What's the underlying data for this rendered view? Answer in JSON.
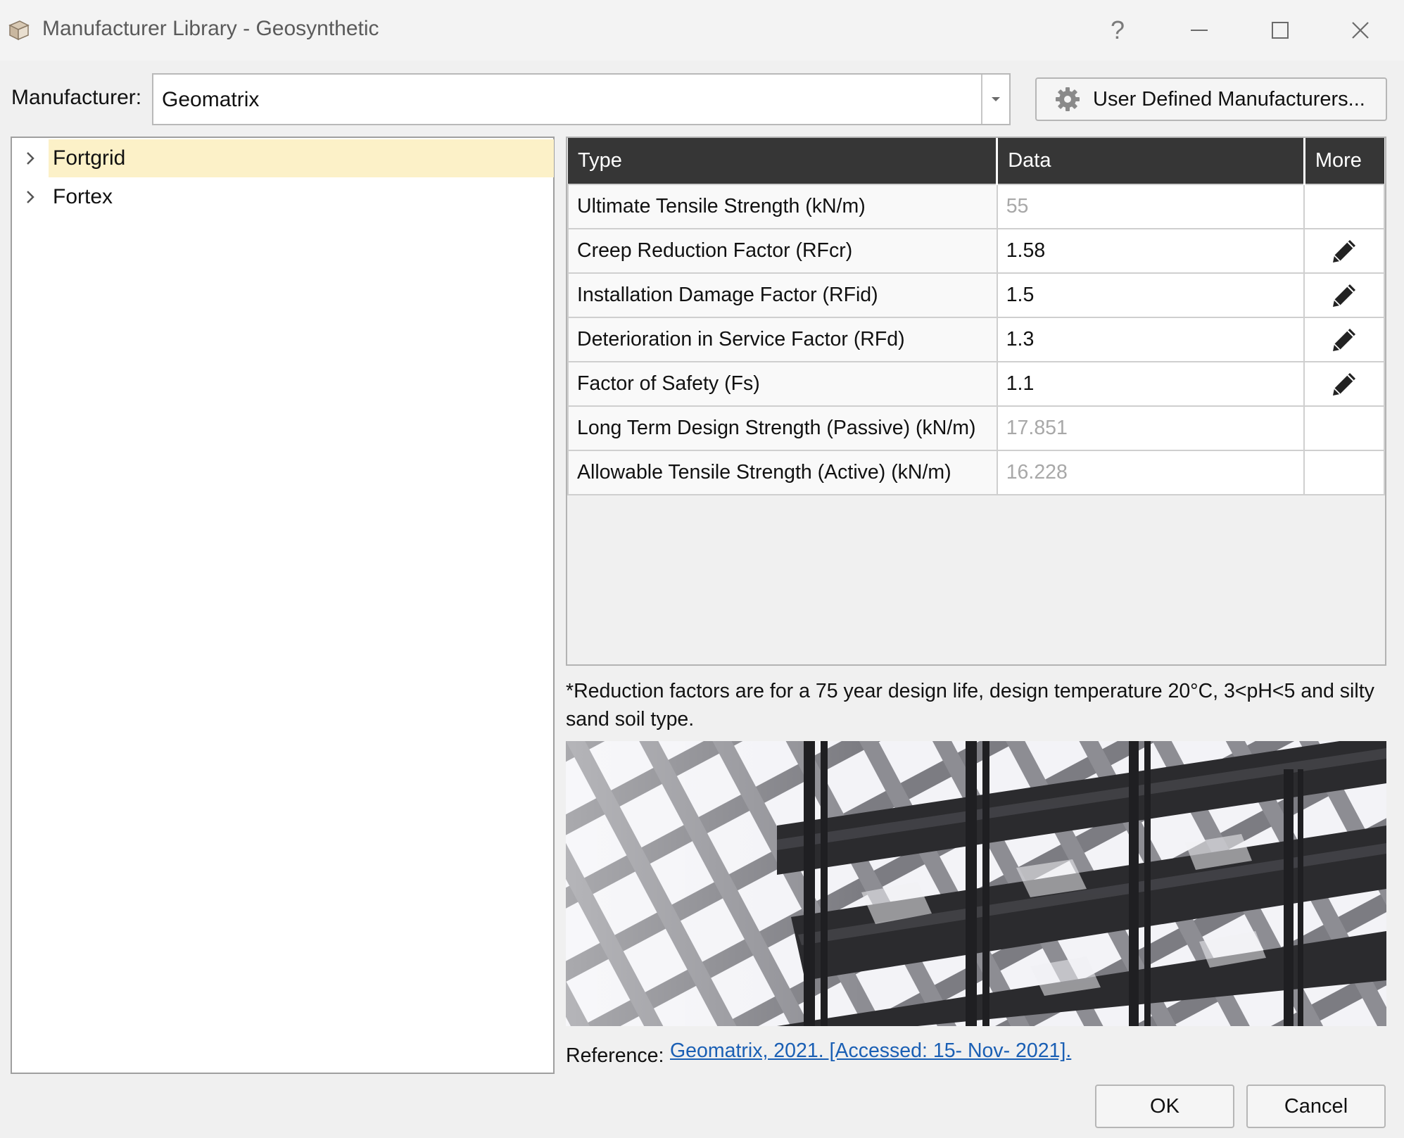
{
  "window": {
    "title": "Manufacturer Library - Geosynthetic",
    "help_glyph": "?"
  },
  "manufacturer": {
    "label": "Manufacturer:",
    "value": "Geomatrix",
    "user_defined_button": "User Defined Manufacturers..."
  },
  "tree": {
    "items": [
      {
        "label": "Fortgrid",
        "selected": true
      },
      {
        "label": "Fortex",
        "selected": false
      }
    ]
  },
  "table": {
    "headers": {
      "type": "Type",
      "data": "Data",
      "more": "More"
    },
    "rows": [
      {
        "type": "Ultimate Tensile Strength (kN/m)",
        "data": "55",
        "editable": false
      },
      {
        "type": "Creep Reduction Factor (RFcr)",
        "data": "1.58",
        "editable": true
      },
      {
        "type": "Installation Damage Factor (RFid)",
        "data": "1.5",
        "editable": true
      },
      {
        "type": "Deterioration in Service Factor (RFd)",
        "data": "1.3",
        "editable": true
      },
      {
        "type": "Factor of Safety (Fs)",
        "data": "1.1",
        "editable": true
      },
      {
        "type": "Long Term Design Strength (Passive) (kN/m)",
        "data": "17.851",
        "editable": false
      },
      {
        "type": "Allowable Tensile Strength (Active) (kN/m)",
        "data": "16.228",
        "editable": false
      }
    ]
  },
  "note": "*Reduction factors are for a 75 year design life, design temperature 20°C, 3<pH<5 and silty sand soil type.",
  "reference": {
    "label": "Reference:",
    "link_text": "Geomatrix, 2021. [Accessed: 15- Nov- 2021]."
  },
  "buttons": {
    "ok": "OK",
    "cancel": "Cancel"
  },
  "icons": {
    "app": "book-stack-icon",
    "gear": "gear-icon",
    "edit": "pencil-icon",
    "expand": "chevron-right-icon",
    "dropdown": "chevron-down-icon"
  },
  "colors": {
    "header_bg": "#363636",
    "selected_bg": "#fcf1c8",
    "link": "#1a5fb4",
    "readonly_text": "#a8a8a8"
  }
}
